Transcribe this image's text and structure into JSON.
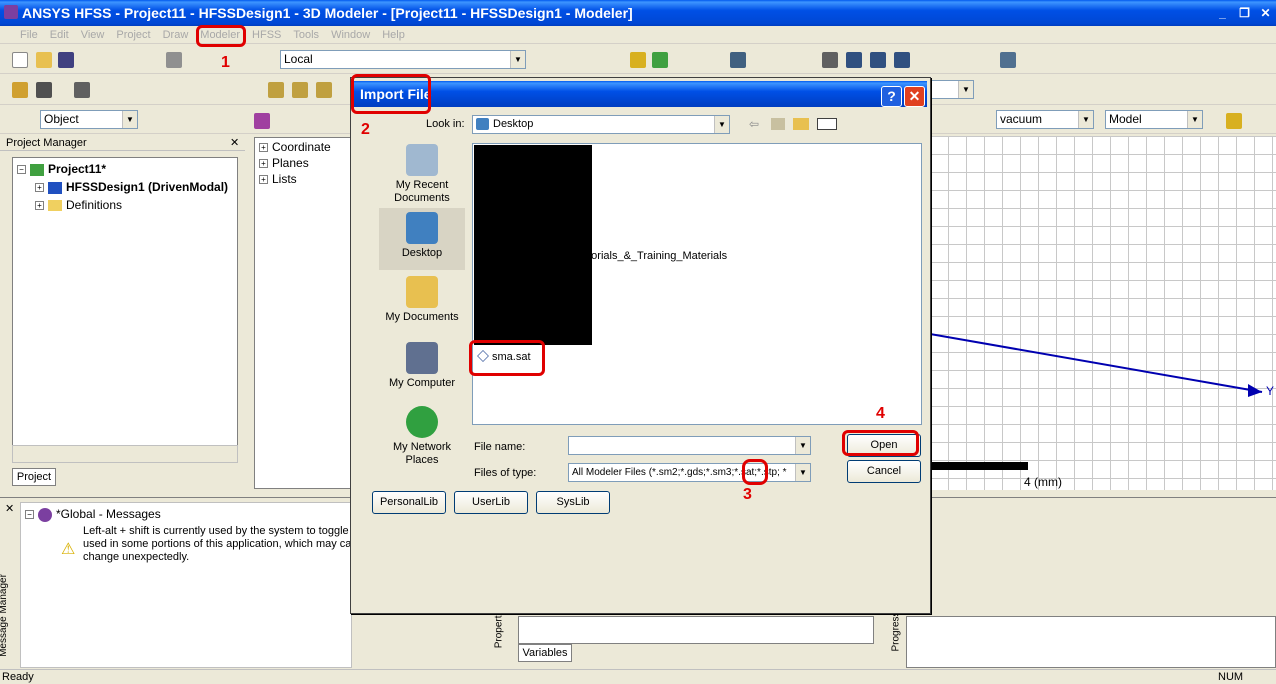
{
  "window": {
    "title": "ANSYS HFSS - Project11 - HFSSDesign1 - 3D Modeler - [Project11 - HFSSDesign1 - Modeler]"
  },
  "menu": [
    "File",
    "Edit",
    "View",
    "Project",
    "Draw",
    "Modeler",
    "HFSS",
    "Tools",
    "Window",
    "Help"
  ],
  "toolbar": {
    "coord_system": "Local",
    "select_mode": "Object",
    "material": "vacuum",
    "view_mode": "Model"
  },
  "project_manager": {
    "title": "Project Manager",
    "project": "Project11*",
    "design": "HFSSDesign1 (DrivenModal)",
    "definitions": "Definitions",
    "tab": "Project"
  },
  "model_tree": [
    "Coordinate",
    "Planes",
    "Lists"
  ],
  "messages": {
    "title": "*Global - Messages",
    "lines": [
      "Left-alt + shift is currently used by the system to toggle the",
      "used in some portions of this application, which may caus",
      "change unexpectedly."
    ],
    "side_label": "Message Manager"
  },
  "properties": {
    "side_label": "Properties",
    "tab": "Variables"
  },
  "progress": {
    "side_label": "Progress"
  },
  "viewport": {
    "axis_label": "Y",
    "scale_label": "4 (mm)"
  },
  "status": {
    "left": "Ready",
    "right": "NUM"
  },
  "dialog": {
    "title": "Import File",
    "look_in_label": "Look in:",
    "look_in_value": "Desktop",
    "places": [
      "My Recent Documents",
      "Desktop",
      "My Documents",
      "My Computer",
      "My Network Places"
    ],
    "files": [
      "utorials_&_Training_Materials",
      "sma.sat"
    ],
    "file_name_label": "File name:",
    "file_name_value": "",
    "files_of_type_label": "Files of type:",
    "files_of_type_value": "All Modeler Files (*.sm2;*.gds;*.sm3;*.sat;*.stp; *",
    "open_button": "Open",
    "cancel_button": "Cancel",
    "lib_buttons": [
      "PersonalLib",
      "UserLib",
      "SysLib"
    ]
  },
  "annotations": [
    "1",
    "2",
    "3",
    "4"
  ]
}
